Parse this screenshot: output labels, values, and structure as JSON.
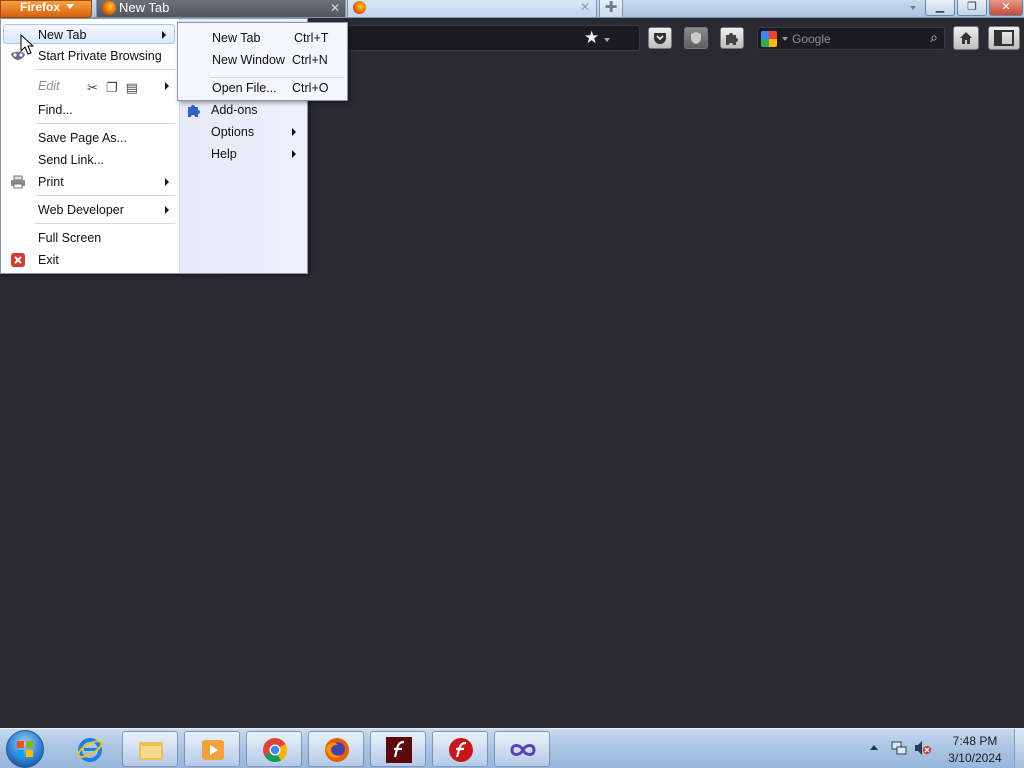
{
  "window": {
    "app_button_label": "Firefox",
    "tabs": [
      {
        "title": "New Tab",
        "close": "✕"
      },
      {
        "title": "",
        "close": "✕"
      }
    ],
    "new_tab_symbol": "✚",
    "controls": {
      "minimize": "▁",
      "restore": "❐",
      "close": "✕"
    }
  },
  "toolbar": {
    "search_placeholder": "Google",
    "search_engine_icon": "google-icon",
    "bookmark_star": "★",
    "search_go": "⌕",
    "home": "⌂"
  },
  "app_menu": {
    "left": [
      {
        "label": "New Tab",
        "submenu": true,
        "highlighted": true
      },
      {
        "label": "Start Private Browsing"
      },
      {
        "label": "Edit",
        "submenu": true,
        "disabled": true
      },
      {
        "label": "Find..."
      },
      {
        "label": "Save Page As..."
      },
      {
        "label": "Send Link..."
      },
      {
        "label": "Print",
        "submenu": true
      },
      {
        "label": "Web Developer",
        "submenu": true
      },
      {
        "label": "Full Screen"
      },
      {
        "label": "Exit"
      }
    ],
    "right": [
      {
        "label": "Add-ons"
      },
      {
        "label": "Options",
        "submenu": true
      },
      {
        "label": "Help",
        "submenu": true
      }
    ]
  },
  "new_tab_submenu": [
    {
      "label": "New Tab",
      "shortcut": "Ctrl+T"
    },
    {
      "label": "New Window",
      "shortcut": "Ctrl+N"
    },
    {
      "label": "Open File...",
      "shortcut": "Ctrl+O"
    }
  ],
  "taskbar": {
    "pinned": [
      "internet-explorer",
      "windows-explorer",
      "media-player",
      "google-chrome",
      "firefox",
      "flash",
      "flash-player",
      "visual-studio"
    ],
    "active_item": "firefox",
    "clock_time": "7:48 PM",
    "clock_date": "3/10/2024"
  },
  "colors": {
    "firefox_orange": "#e66000",
    "content_background": "#2b2a33",
    "menu_highlight": "#d9e8fb",
    "taskbar": "#a9c3e3"
  }
}
